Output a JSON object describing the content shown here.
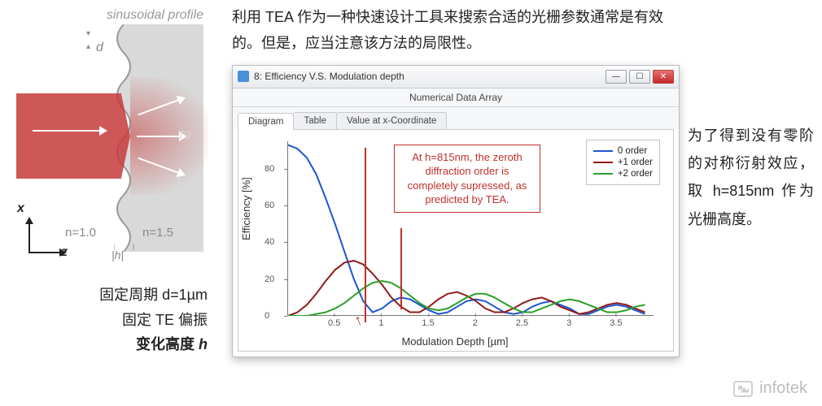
{
  "left": {
    "sin_label": "sinusoidal profile",
    "d_label": "d",
    "orders": {
      "t_plus1": "T+1",
      "t_zero": "T0",
      "t_minus1": "T-1"
    },
    "n_left": "n=1.0",
    "n_right": "n=1.5",
    "h_label": "|h|",
    "axes": {
      "x": "x",
      "z": "z"
    },
    "caption1": "固定周期 d=1µm",
    "caption2": "固定 TE 偏振",
    "caption3_prefix": "变化高度 ",
    "caption3_var": "h"
  },
  "top_text": "利用 TEA 作为一种快速设计工具来搜索合适的光栅参数通常是有效的。但是，应当注意该方法的局限性。",
  "window": {
    "title": "8: Efficiency V.S. Modulation depth",
    "subtitle": "Numerical Data Array",
    "tabs": [
      "Diagram",
      "Table",
      "Value at x-Coordinate"
    ],
    "btn_min": "—",
    "btn_max": "☐",
    "btn_close": "✕",
    "yaxis": "Efficiency [%]",
    "xaxis": "Modulation Depth [µm]",
    "yticks": [
      "0",
      "20",
      "40",
      "60",
      "80"
    ],
    "xticks": [
      "0.5",
      "1",
      "1.5",
      "2",
      "2.5",
      "3",
      "3.5"
    ],
    "legend": [
      "0 order",
      "+1 order",
      "+2 order"
    ],
    "callout": "At h=815nm, the zeroth diffraction order is completely supressed, as predicted by TEA.",
    "arrow": "↑"
  },
  "chart_data": {
    "type": "line",
    "title": "Efficiency V.S. Modulation depth",
    "xlabel": "Modulation Depth [µm]",
    "ylabel": "Efficiency [%]",
    "xlim": [
      0,
      3.9
    ],
    "ylim": [
      0,
      95
    ],
    "annotation_x": 0.815,
    "x": [
      0.0,
      0.1,
      0.2,
      0.3,
      0.4,
      0.5,
      0.6,
      0.7,
      0.8,
      0.9,
      1.0,
      1.1,
      1.2,
      1.3,
      1.4,
      1.5,
      1.6,
      1.7,
      1.8,
      1.9,
      2.0,
      2.1,
      2.2,
      2.3,
      2.4,
      2.5,
      2.6,
      2.7,
      2.8,
      2.9,
      3.0,
      3.1,
      3.2,
      3.3,
      3.4,
      3.5,
      3.6,
      3.7,
      3.8
    ],
    "series": [
      {
        "name": "0 order",
        "color": "#1f55d0",
        "values": [
          93,
          91,
          86,
          77,
          64,
          50,
          35,
          20,
          8,
          2,
          4,
          8,
          10,
          9,
          6,
          3,
          1,
          2,
          5,
          8,
          9,
          8,
          5,
          2,
          1,
          2,
          5,
          7,
          8,
          6,
          4,
          1,
          1,
          3,
          5,
          6,
          5,
          3,
          1
        ]
      },
      {
        "name": "+1 order",
        "color": "#8e1b1b",
        "values": [
          0,
          2,
          6,
          12,
          19,
          25,
          29,
          30,
          28,
          23,
          17,
          10,
          5,
          2,
          2,
          5,
          9,
          12,
          13,
          11,
          8,
          4,
          2,
          2,
          4,
          7,
          9,
          10,
          8,
          5,
          3,
          1,
          2,
          4,
          6,
          7,
          6,
          4,
          2
        ]
      },
      {
        "name": "+2 order",
        "color": "#2aa02a",
        "values": [
          0,
          0,
          0,
          1,
          2,
          4,
          7,
          11,
          15,
          18,
          19,
          18,
          15,
          11,
          7,
          4,
          3,
          4,
          7,
          10,
          12,
          12,
          10,
          7,
          4,
          2,
          2,
          4,
          6,
          8,
          9,
          8,
          6,
          4,
          2,
          2,
          3,
          5,
          6
        ]
      }
    ]
  },
  "right_text": "为了得到没有零阶的对称衍射效应，取 h=815nm 作为光栅高度。",
  "watermark": "infotek"
}
